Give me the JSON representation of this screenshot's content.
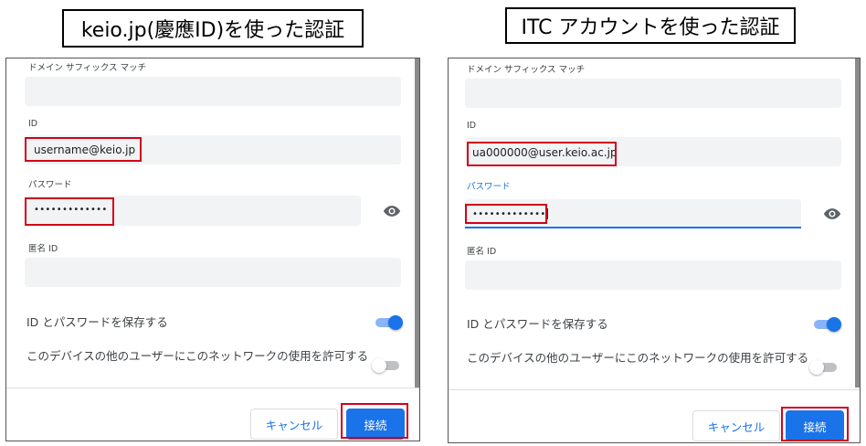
{
  "titles": {
    "left": "keio.jp(慶應ID)を使った認証",
    "right": "ITC アカウントを使った認証"
  },
  "left": {
    "domain_suffix_label": "ドメイン サフィックス マッチ",
    "id_label": "ID",
    "id_value": "username@keio.jp",
    "password_label": "パスワード",
    "password_value": "•••••••••••••",
    "anon_id_label": "匿名 ID",
    "save_label": "ID とパスワードを保存する",
    "share_label": "このデバイスの他のユーザーにこのネットワークの使用を許可する",
    "cancel": "キャンセル",
    "connect": "接続"
  },
  "right": {
    "domain_suffix_label": "ドメイン サフィックス マッチ",
    "id_label": "ID",
    "id_value": "ua000000@user.keio.ac.jp",
    "password_label": "パスワード",
    "password_value": "•••••••••••••",
    "anon_id_label": "匿名 ID",
    "save_label": "ID とパスワードを保存する",
    "share_label": "このデバイスの他のユーザーにこのネットワークの使用を許可する",
    "cancel": "キャンセル",
    "connect": "接続"
  },
  "toggles": {
    "save_on": true,
    "share_on": false
  },
  "colors": {
    "accent": "#1a73e8",
    "highlight": "#d0021b",
    "field_bg": "#f1f3f4"
  }
}
